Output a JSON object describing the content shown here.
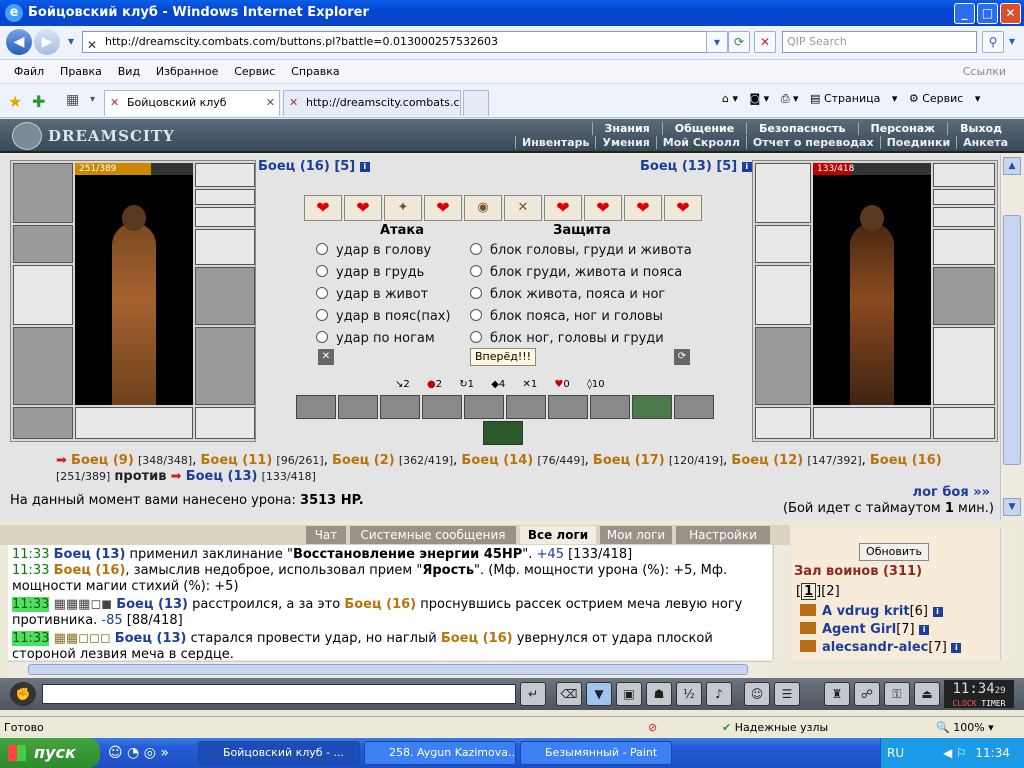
{
  "window": {
    "title": "Бойцовский клуб - Windows Internet Explorer",
    "minimize": "_",
    "maximize": "□",
    "close": "✕"
  },
  "address": {
    "url": "http://dreamscity.combats.com/buttons.pl?battle=0.013000257532603",
    "search_placeholder": "QIP Search"
  },
  "menu": {
    "items": [
      "Файл",
      "Правка",
      "Вид",
      "Избранное",
      "Сервис",
      "Справка"
    ],
    "links": "Ссылки"
  },
  "tabs": [
    {
      "label": "Бойцовский клуб",
      "active": true
    },
    {
      "label": "http://dreamscity.combats.c...",
      "active": false
    }
  ],
  "toolbar_right": {
    "page": "Страница",
    "service": "Сервис"
  },
  "game_header": {
    "logo": "DREAMSCITY",
    "nav_top": [
      "Знания",
      "Общение",
      "Безопасность",
      "Персонаж",
      "Выход"
    ],
    "nav_bottom": [
      "Инвентарь",
      "Умения",
      "Мой Скролл",
      "Отчет о переводах",
      "Поединки",
      "Анкета"
    ]
  },
  "fighters": {
    "left": {
      "name": "Боец (16) [5]",
      "hp": "251/389",
      "hp_fraction": 0.645
    },
    "right": {
      "name": "Боец (13) [5]",
      "hp": "133/418",
      "hp_fraction": 0.318
    }
  },
  "info_glyph": "i",
  "hearts": [
    "❤",
    "❤",
    "✦",
    "❤",
    "◉",
    "✕",
    "❤",
    "❤",
    "❤",
    "❤"
  ],
  "attack": {
    "title": "Атака",
    "options": [
      "удар в голову",
      "удар в грудь",
      "удар в живот",
      "удар в пояс(пах)",
      "удар по ногам"
    ]
  },
  "defense": {
    "title": "Защита",
    "options": [
      "блок головы, груди и живота",
      "блок груди, живота и пояса",
      "блок живота, пояса и ног",
      "блок пояса, ног и головы",
      "блок ног, головы и груди"
    ]
  },
  "forward_button": "Вперёд!!!",
  "stats": [
    "2",
    "2",
    "1",
    "4",
    "1",
    "0",
    "10"
  ],
  "opponents": {
    "list": [
      {
        "name": "Боец (9)",
        "hp": "[348/348]"
      },
      {
        "name": "Боец (11)",
        "hp": "[96/261]"
      },
      {
        "name": "Боец (2)",
        "hp": "[362/419]"
      },
      {
        "name": "Боец (14)",
        "hp": "[76/449]"
      },
      {
        "name": "Боец (17)",
        "hp": "[120/419]"
      },
      {
        "name": "Боец (12)",
        "hp": "[147/392]"
      },
      {
        "name": "Боец (16)",
        "hp": "[251/389]"
      }
    ],
    "versus": "против",
    "target": {
      "name": "Боец (13)",
      "hp": "[133/418]"
    }
  },
  "damage": {
    "label": "На данный момент вами нанесено урона:",
    "value": "3513 HP."
  },
  "log_link": "лог боя »»",
  "timeout": {
    "prefix": "(Бой идет с таймаутом",
    "value": "1",
    "suffix": "мин.)"
  },
  "chat_tabs": [
    "Чат",
    "Системные сообщения",
    "Все логи",
    "Мои логи",
    "Настройки"
  ],
  "chat_log": [
    {
      "time": "11:33",
      "who": "Боец (13)",
      "text1": " применил заклинание \"",
      "bold": "Восстановление энергии 45HP",
      "text2": "\". ",
      "plus": "+45",
      "tail": " [133/418]"
    },
    {
      "time": "11:33",
      "who": "Боец (16)",
      "text1": ", замыслив недоброе, использовал прием \"",
      "bold": "Ярость",
      "text2": "\". (Мф. мощности урона (%): +5, Мф. мощности магии стихий (%): +5)"
    },
    {
      "time": "11:33",
      "blocks": "▦▦▦◻◼",
      "who": "Боец (13)",
      "text1": " расстроился, а за это ",
      "enemy": "Боец (16)",
      "text2": " проснувшись рассек острием меча левую ногу противника. ",
      "minus": "-85",
      "tail": " [88/418]"
    },
    {
      "time": "11:33",
      "blocks": "▦▦◻◻◻",
      "who": "Боец (13)",
      "text1": " старался провести удар, но наглый ",
      "enemy": "Боец (16)",
      "text2": " увернулся от удара плоской стороной лезвия меча в сердце."
    }
  ],
  "warriors": {
    "refresh": "Обновить",
    "title": "Зал воинов (311)",
    "page_current": "1",
    "page_other": "2",
    "list": [
      {
        "name": "A vdrug krit",
        "lvl": "[6]"
      },
      {
        "name": "Agent Girl",
        "lvl": "[7]"
      },
      {
        "name": "alecsandr-alec",
        "lvl": "[7]"
      }
    ]
  },
  "clock": {
    "time": "11:34",
    "sec": "29",
    "clock_label": "CLOCK",
    "timer_label": "TIMER"
  },
  "status": {
    "ready": "Готово",
    "zone": "Надежные узлы",
    "zoom": "100%"
  },
  "taskbar": {
    "start": "пуск",
    "tasks": [
      {
        "label": "Бойцовский клуб - ...",
        "active": true
      },
      {
        "label": "258. Aygun Kazimova...",
        "active": false
      },
      {
        "label": "Безымянный - Paint",
        "active": false
      }
    ],
    "lang": "RU",
    "time": "11:34"
  }
}
